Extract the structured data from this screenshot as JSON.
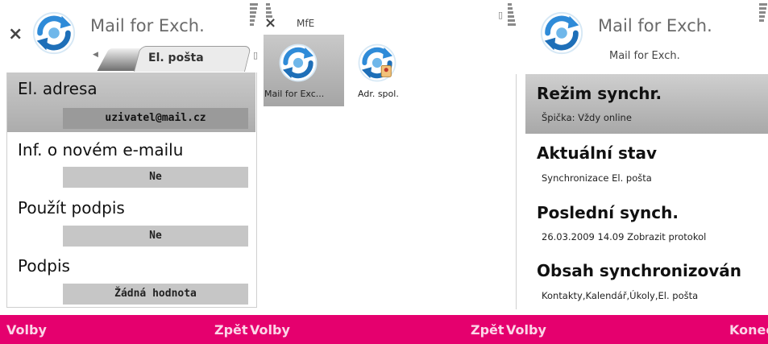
{
  "colors": {
    "softkey_bar": "#e5006e",
    "highlight": "#acacac",
    "value_box": "#c6c6c6"
  },
  "screen1": {
    "title": "Mail for Exch.",
    "tab_label": "El. pošta",
    "fields": [
      {
        "label": "El. adresa",
        "value": "uzivatel@mail.cz"
      },
      {
        "label": "Inf. o novém e-mailu",
        "value": "Ne"
      },
      {
        "label": "Použít podpis",
        "value": "Ne"
      },
      {
        "label": "Podpis",
        "value": "Žádná hodnota"
      }
    ],
    "softkeys": {
      "left": "Volby",
      "right": "Zpět"
    }
  },
  "screen2": {
    "title": "MfE",
    "apps": [
      {
        "label": "Mail for Exc...",
        "icon": "sync-icon"
      },
      {
        "label": "Adr. spol.",
        "icon": "sync-contacts-icon"
      }
    ],
    "softkeys": {
      "left": "Volby",
      "right": "Zpět"
    }
  },
  "screen3": {
    "title": "Mail for Exch.",
    "subtitle": "Mail for Exch.",
    "items": [
      {
        "label": "Režim synchr.",
        "value": "Špička: Vždy online"
      },
      {
        "label": "Aktuální stav",
        "value": "Synchronizace El. pošta"
      },
      {
        "label": "Poslední synch.",
        "value": "26.03.2009 14.09 Zobrazit protokol"
      },
      {
        "label": "Obsah synchronizován",
        "value": "Kontakty,Kalendář,Úkoly,El. pošta"
      }
    ],
    "softkeys": {
      "left": "Volby",
      "right": "Konec"
    }
  }
}
